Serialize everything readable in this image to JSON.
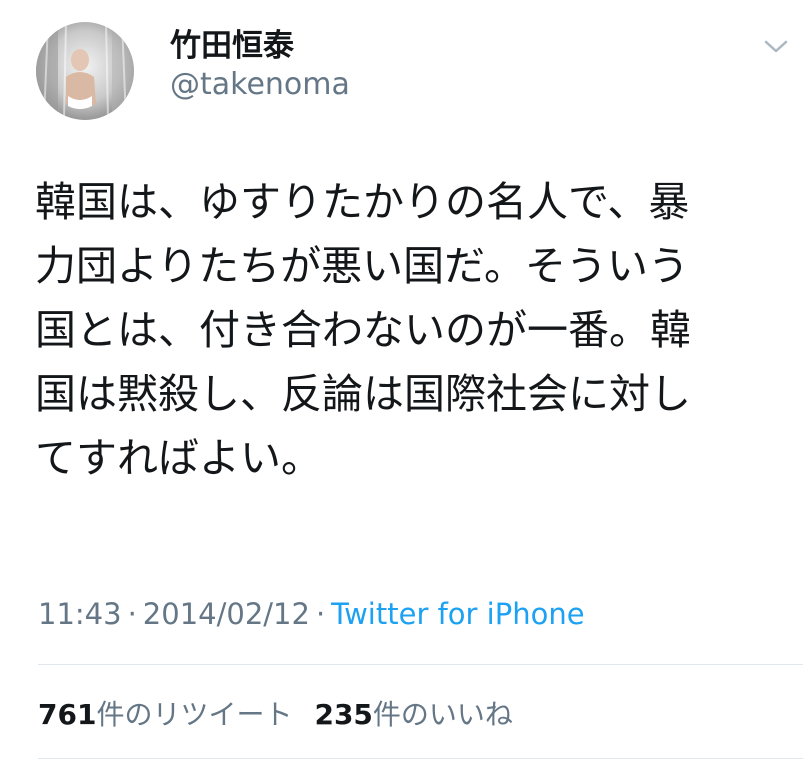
{
  "author": {
    "display_name": "竹田恒泰",
    "handle": "@takenoma"
  },
  "icons": {
    "menu": "chevron-down-icon"
  },
  "tweet": {
    "lines": [
      "韓国は、ゆすりたかりの名人で、暴",
      "力団よりたちが悪い国だ。そういう",
      "国とは、付き合わないのが一番。韓",
      "国は黙殺し、反論は国際社会に対し",
      "てすればよい。"
    ],
    "time": "11:43",
    "separator": "·",
    "date": "2014/02/12",
    "source": "Twitter for iPhone"
  },
  "stats": {
    "retweets": {
      "count": "761",
      "label": "件のリツイート"
    },
    "likes": {
      "count": "235",
      "label": "件のいいね"
    }
  },
  "colors": {
    "text": "#14171a",
    "secondary": "#657786",
    "link": "#1da1f2",
    "divider": "#e1e8ed"
  }
}
